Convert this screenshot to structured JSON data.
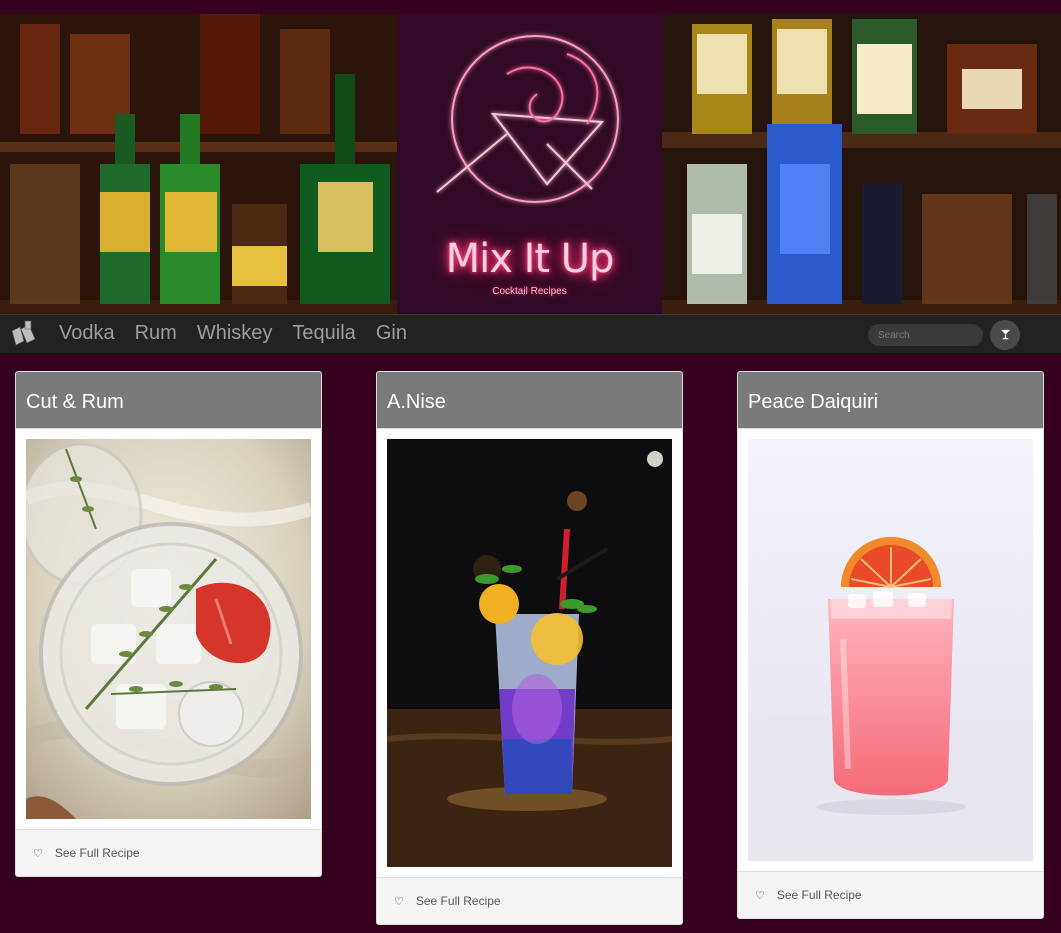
{
  "banner": {
    "title": "Mix It Up",
    "subtitle": "Cocktail Recipes"
  },
  "nav": {
    "links": [
      "Vodka",
      "Rum",
      "Whiskey",
      "Tequila",
      "Gin"
    ],
    "search_placeholder": "Search"
  },
  "cards": [
    {
      "title": "Cut & Rum",
      "link_label": "See Full Recipe"
    },
    {
      "title": "A.Nise",
      "link_label": "See Full Recipe"
    },
    {
      "title": "Peace Daiquiri",
      "link_label": "See Full Recipe"
    }
  ],
  "colors": {
    "page_background": "#36001f",
    "navbar": "#222222",
    "card_header": "#7a7a7a",
    "neon_pink": "#ff2d6f"
  },
  "icons": {
    "brand": "cocktail-glasses-icon",
    "search_button": "martini-glass-icon",
    "card_footer": "heart-icon"
  }
}
